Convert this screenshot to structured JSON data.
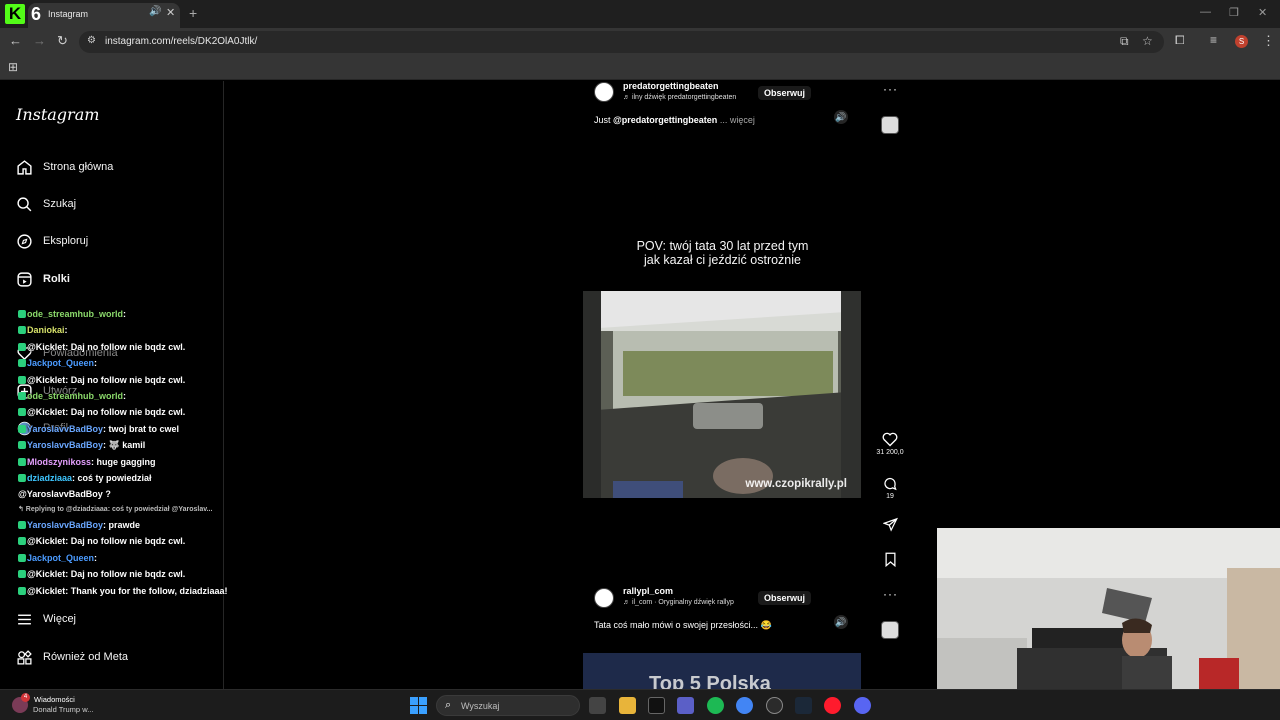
{
  "browser": {
    "tab_favicon": "6",
    "tab_title": "Instagram",
    "url": "instagram.com/reels/DK2OlA0Jtlk/",
    "profile_initial": "S"
  },
  "sidebar": {
    "logo": "Instagram",
    "items": [
      {
        "label": "Strona główna",
        "icon": "home-icon"
      },
      {
        "label": "Szukaj",
        "icon": "search-icon"
      },
      {
        "label": "Eksploruj",
        "icon": "compass-icon"
      },
      {
        "label": "Rolki",
        "icon": "reels-icon"
      },
      {
        "label": "Powiadomienia",
        "icon": "heart-icon"
      },
      {
        "label": "Utwórz",
        "icon": "plus-icon"
      },
      {
        "label": "Profil",
        "icon": "profile-icon"
      },
      {
        "label": "Więcej",
        "icon": "menu-icon"
      },
      {
        "label": "Również od Meta",
        "icon": "meta-icon"
      }
    ]
  },
  "reel1": {
    "author": "predatorgettingbeaten",
    "audio": "♬ ilny dźwięk  predatorgettingbeaten",
    "follow": "Obserwuj",
    "caption_prefix": "Just ",
    "caption_mention": "@predatorgettingbeaten",
    "caption_more": " ... więcej",
    "overlay_line1": "POV: twój tata 30 lat przed tym",
    "overlay_line2": "jak kazał ci jeździć ostrożnie",
    "watermark": "www.czopikrally.pl",
    "likes": "31 200,0",
    "comments": "19"
  },
  "reel2": {
    "author": "rallypl_com",
    "audio": "♬ il_com · Oryginalny dźwięk     rallyp",
    "follow": "Obserwuj",
    "caption": "Tata coś mało mówi o swojej przesłości... 😂",
    "preview_text": "Top 5 Polska"
  },
  "chat": [
    {
      "user": "ode_streamhub_world",
      "text": "",
      "color": "#8bd96b"
    },
    {
      "user": "Daniokai",
      "text": "",
      "color": "#d7e26a"
    },
    {
      "user": "@Kicklet",
      "text": " Daj no follow nie bqdz cwl.",
      "color": "#ffffff"
    },
    {
      "user": "Jackpot_Queen",
      "text": "",
      "color": "#4b9bff"
    },
    {
      "user": "@Kicklet",
      "text": " Daj no follow nie bqdz cwl.",
      "color": "#ffffff"
    },
    {
      "user": "ode_streamhub_world",
      "text": "",
      "color": "#8bd96b"
    },
    {
      "user": "@Kicklet",
      "text": " Daj no follow nie bqdz cwl.",
      "color": "#ffffff"
    },
    {
      "user": "YaroslavvBadBoy",
      "text": " twoj brat to cwel",
      "color": "#6aa7ff"
    },
    {
      "user": "YaroslavvBadBoy",
      "text": " 🐺 kamil",
      "color": "#6aa7ff"
    },
    {
      "user": "Mlodszynikoss",
      "text": " huge gagging",
      "color": "#e5a0ff"
    },
    {
      "user": "dziadziaaa",
      "text": " coś ty powiedział @YaroslavvBadBoy ?",
      "color": "#3ec6ff"
    },
    {
      "reply": "↰ Replying to @dziadziaaa: coś ty powiedział @Yaroslav..."
    },
    {
      "user": "YaroslavvBadBoy",
      "text": " prawde",
      "color": "#6aa7ff"
    },
    {
      "user": "@Kicklet",
      "text": " Daj no follow nie bqdz cwl.",
      "color": "#ffffff"
    },
    {
      "user": "Jackpot_Queen",
      "text": "",
      "color": "#4b9bff"
    },
    {
      "user": "@Kicklet",
      "text": " Daj no follow nie bqdz cwl.",
      "color": "#ffffff"
    },
    {
      "user": "@Kicklet",
      "text": " Thank you for the follow, dziadziaaa!",
      "color": "#ffffff"
    }
  ],
  "taskbar": {
    "news_badge": "4",
    "news_title": "Wiadomości",
    "news_sub": "Donald Trump w...",
    "search_placeholder": "Wyszukaj"
  }
}
